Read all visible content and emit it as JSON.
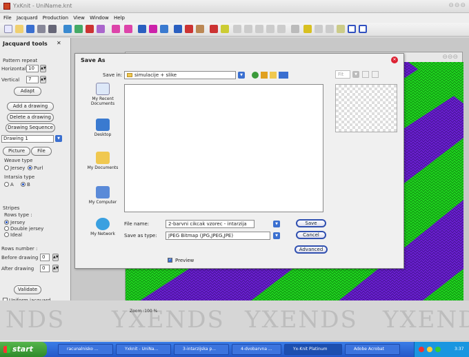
{
  "window": {
    "title": "YxKnit - UniName.knt"
  },
  "menu": [
    "File",
    "Jacquard",
    "Production",
    "View",
    "Window",
    "Help"
  ],
  "left_panel": {
    "title": "Jacquard tools",
    "pattern_repeat_label": "Pattern repeat",
    "horizontal_label": "Horizontal",
    "horizontal_value": "10",
    "vertical_label": "Vertical",
    "vertical_value": "7",
    "adapt": "Adapt",
    "add_drawing": "Add a drawing",
    "delete_drawing": "Delete a drawing",
    "drawing_sequence": "Drawing Sequence",
    "drawing_select": "Drawing 1",
    "picture": "Picture",
    "file": "File",
    "weave_type_label": "Weave type",
    "jersey": "Jersey",
    "purl": "Purl",
    "intarsia_label": "Intarsia type",
    "option_a": "A",
    "option_b": "B",
    "stripes_label": "Stripes",
    "rows_type_label": "Rows type :",
    "rows_jersey": "Jersey",
    "rows_double_jersey": "Double jersey",
    "rows_ideal": "Ideal",
    "rows_number_label": "Rows number :",
    "before_drawing_label": "Before drawing",
    "before_drawing_value": "0",
    "after_drawing_label": "After drawing",
    "after_drawing_value": "0",
    "validate": "Validate",
    "uniform_jacquard": "Uniform jacquard"
  },
  "dialog": {
    "title": "Save As",
    "save_in_label": "Save in:",
    "save_in_value": "simulacije + slike",
    "places": [
      "My Recent Documents",
      "Desktop",
      "My Documents",
      "My Computer",
      "My Network"
    ],
    "file_name_label": "File name:",
    "file_name_value": "2-barvni cikcak vzorec - intarzija",
    "save_as_type_label": "Save as type:",
    "save_as_type_value": "JPEG Bitmap (JPG,JPEG,JPE)",
    "save": "Save",
    "cancel": "Cancel",
    "advanced": "Advanced",
    "preview_label": "Preview",
    "preview_checked": true,
    "fit": "Fit"
  },
  "zoom": "Zoom :100 %",
  "logo": [
    "NDS",
    "YXENDS",
    "YXENDS",
    "YXENDS"
  ],
  "colors": {
    "purple": "#6a1fd0",
    "green": "#1fd31f",
    "accent": "#3050b0"
  },
  "taskbar": {
    "start": "start",
    "items": [
      "racunalnisko ...",
      "Yxknit - UniNa...",
      "3-intarzijska p...",
      "4-dvobarvna ...",
      "Yx-Knit Platinum",
      "Adobe Acrobat"
    ],
    "time": "3:37"
  }
}
